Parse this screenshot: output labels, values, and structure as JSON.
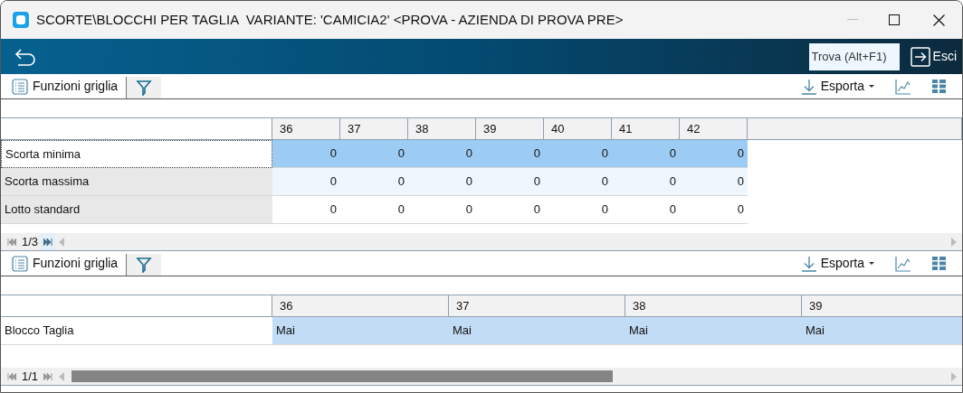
{
  "window": {
    "title": "SCORTE\\BLOCCHI PER TAGLIA  VARIANTE: 'CAMICIA2' <PROVA - AZIENDA DI PROVA PRE>"
  },
  "top_bar": {
    "search": {
      "placeholder": "Trova (Alt+F1)"
    },
    "exit_button": "Esci"
  },
  "grids": [
    {
      "focused": true,
      "toolbar": {
        "functions": "Funzioni griglia",
        "export": "Esporta"
      },
      "columns": [
        "36",
        "37",
        "38",
        "39",
        "40",
        "41",
        "42"
      ],
      "rows": [
        {
          "label": "Scorta minima",
          "selected": true,
          "cells": [
            "0",
            "0",
            "0",
            "0",
            "0",
            "0",
            "0"
          ]
        },
        {
          "label": "Scorta massima",
          "selected": false,
          "cells": [
            "0",
            "0",
            "0",
            "0",
            "0",
            "0",
            "0"
          ]
        },
        {
          "label": "Lotto standard",
          "selected": false,
          "cells": [
            "0",
            "0",
            "0",
            "0",
            "0",
            "0",
            "0"
          ]
        }
      ],
      "pager": "1/3"
    },
    {
      "focused": false,
      "toolbar": {
        "functions": "Funzioni griglia",
        "export": "Esporta"
      },
      "columns": [
        "36",
        "37",
        "38",
        "39"
      ],
      "rows": [
        {
          "label": "Blocco Taglia",
          "selected": true,
          "cells": [
            "Mai",
            "Mai",
            "Mai",
            "Mai"
          ]
        }
      ],
      "pager": "1/1"
    }
  ]
}
